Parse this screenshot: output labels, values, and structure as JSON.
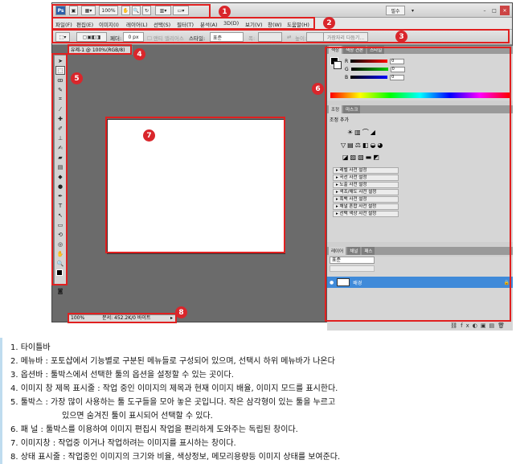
{
  "appbar": {
    "zoom": "100%",
    "workspace": "필수"
  },
  "menubar": {
    "items": [
      "파일(F)",
      "편집(E)",
      "이미지(I)",
      "레이어(L)",
      "선택(S)",
      "필터(T)",
      "분석(A)",
      "3D(D)",
      "보기(V)",
      "창(W)",
      "도움말(H)"
    ]
  },
  "optbar": {
    "feather_label": "페더:",
    "feather_value": "0 px",
    "antialias_label": "앤티 앨리어스",
    "style_label": "스타일:",
    "style_value": "표준",
    "width_label": "폭:",
    "height_label": "높이:",
    "refine_button": "가장자리 다듬기..."
  },
  "document": {
    "tab_title": "유제-1 @ 100%(RGB/8)",
    "status_zoom": "100%",
    "status_doc": "문서: 452.2K/0 바이트"
  },
  "panels": {
    "color_tabs": [
      "색상",
      "색상 견본",
      "스타일"
    ],
    "color_channels": [
      {
        "label": "R",
        "value": "0",
        "color": "#ff0000"
      },
      {
        "label": "G",
        "value": "0",
        "color": "#00cc00"
      },
      {
        "label": "B",
        "value": "0",
        "color": "#0000ff"
      }
    ],
    "adjust_tabs": [
      "조정",
      "마스크"
    ],
    "adjust_title": "조정 추가",
    "presets": [
      "레벨 사전 설정",
      "곡선 사전 설정",
      "노출 사전 설정",
      "색조/채도 사전 설정",
      "흑백 사전 설정",
      "채널 혼합 사전 설정",
      "선택 색상 사전 설정"
    ],
    "layer_tabs": [
      "레이어",
      "채널",
      "패스"
    ],
    "blend_mode": "표준",
    "layer_name": "배경"
  },
  "markers": [
    "1",
    "2",
    "3",
    "4",
    "5",
    "6",
    "7",
    "8"
  ],
  "caption": {
    "lines": [
      "1. 타이틀바",
      "2. 메뉴바  :  포토샵에서 기능별로 구분된 메뉴들로 구성되어 있으며, 선택시 하위 메뉴바가 나온다",
      "3. 옵션바  :  툴박스에서 선택한 툴의 옵션을 설정할 수 있는 곳이다.",
      "4. 이미지 창 제목 표시줄  :  작업 중인 이미지의 제목과 현재 이미지 배율, 이미지 모드를 표시한다.",
      "5. 툴박스 : 가장 많이 사용하는 툴 도구들을 모아 놓은 곳입니다. 작은 삼각형이 있는 툴을 누르고",
      "있으면 숨겨진 툴이 표시되어 선택할 수 있다.",
      "6. 패 널  :  툴박스를 이용하여 이미지 편집시 작업을 편리하게 도와주는 독립된 창이다.",
      "7. 이미지창  :  작업중 이거나 작업하려는 이미지를 표시하는 창이다.",
      "8. 상태 표시줄  :  작업중인 이미지의 크기와 비율, 색상정보, 메모리용량등 이미지 상태를 보여준다."
    ]
  },
  "colors": {
    "marker_red": "#d9262b",
    "highlight_border": "#e02020",
    "layer_selected": "#3f8ad9"
  }
}
